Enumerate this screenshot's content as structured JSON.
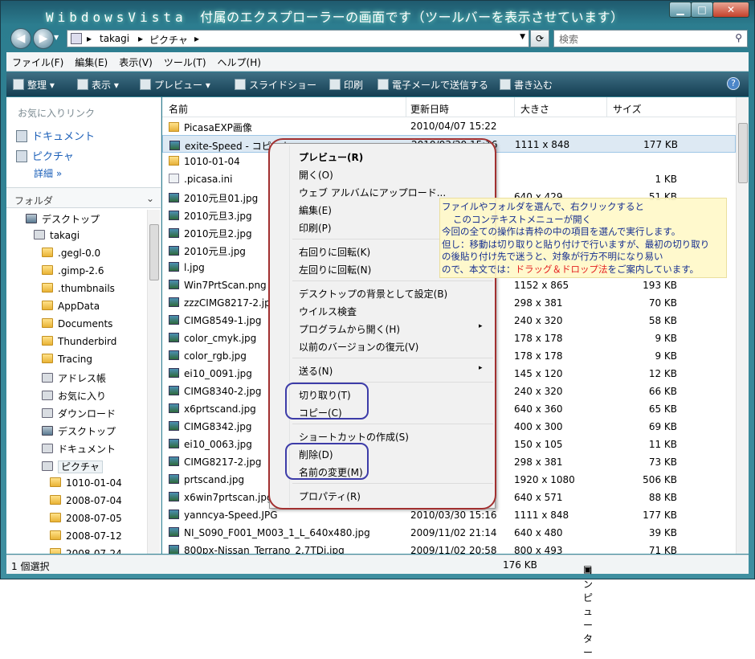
{
  "window": {
    "title_latin": "WibdowsVista",
    "title_rest": "付属のエクスプローラーの画面です（ツールバーを表示させています）",
    "buttons": {
      "minimize": "▁",
      "maximize": "□",
      "close": "✕"
    }
  },
  "address": {
    "crumbs": [
      "takagi",
      "ピクチャ"
    ],
    "separator": "▸",
    "search_placeholder": "検索"
  },
  "menubar": [
    "ファイル(F)",
    "編集(E)",
    "表示(V)",
    "ツール(T)",
    "ヘルプ(H)"
  ],
  "toolbar": {
    "organize": "整理",
    "view": "表示",
    "preview": "プレビュー",
    "slideshow": "スライドショー",
    "print": "印刷",
    "email": "電子メールで送信する",
    "burn": "書き込む",
    "dropdown": "▾",
    "help": "?"
  },
  "nav": {
    "favorites_header": "お気に入りリンク",
    "favorites": [
      "ドキュメント",
      "ピクチャ"
    ],
    "more_label": "詳細",
    "more_glyph": "»",
    "folders_header": "フォルダ",
    "folders_chevron": "⌄",
    "tree": [
      "デスクトップ",
      "takagi",
      ".gegl-0.0",
      ".gimp-2.6",
      ".thumbnails",
      "AppData",
      "Documents",
      "Thunderbird",
      "Tracing",
      "アドレス帳",
      "お気に入り",
      "ダウンロード",
      "デスクトップ",
      "ドキュメント",
      "ピクチャ",
      "1010-01-04",
      "2008-07-04",
      "2008-07-05",
      "2008-07-12",
      "2008-07-24"
    ]
  },
  "columns": {
    "name": "名前",
    "date": "更新日時",
    "dims": "大きさ",
    "size": "サイズ"
  },
  "files": [
    {
      "name": "PicasaEXP画像",
      "date": "2010/04/07 15:22",
      "dims": "",
      "size": ""
    },
    {
      "name": "exite-Speed - コピー.jpg",
      "date": "2010/03/30 15:16",
      "dims": "1111 x 848",
      "size": "177 KB"
    },
    {
      "name": "1010-01-04",
      "date": "",
      "dims": "",
      "size": ""
    },
    {
      "name": ".picasa.ini",
      "date": "",
      "dims": "",
      "size": "1 KB"
    },
    {
      "name": "2010元旦01.jpg",
      "date": "",
      "dims": "640 x 429",
      "size": "51 KB"
    },
    {
      "name": "2010元旦3.jpg",
      "date": "",
      "dims": "",
      "size": ""
    },
    {
      "name": "2010元旦2.jpg",
      "date": "",
      "dims": "",
      "size": ""
    },
    {
      "name": "2010元旦.jpg",
      "date": "",
      "dims": "",
      "size": ""
    },
    {
      "name": "l.jpg",
      "date": "",
      "dims": "",
      "size": ""
    },
    {
      "name": "Win7PrtScan.png",
      "date": "",
      "dims": "1152 x 865",
      "size": "193 KB"
    },
    {
      "name": "zzzCIMG8217-2.jpg",
      "date": "",
      "dims": "298 x 381",
      "size": "70 KB"
    },
    {
      "name": "CIMG8549-1.jpg",
      "date": "",
      "dims": "240 x 320",
      "size": "58 KB"
    },
    {
      "name": "color_cmyk.jpg",
      "date": "",
      "dims": "178 x 178",
      "size": "9 KB"
    },
    {
      "name": "color_rgb.jpg",
      "date": "",
      "dims": "178 x 178",
      "size": "9 KB"
    },
    {
      "name": "ei10_0091.jpg",
      "date": "",
      "dims": "145 x 120",
      "size": "12 KB"
    },
    {
      "name": "CIMG8340-2.jpg",
      "date": "",
      "dims": "240 x 320",
      "size": "66 KB"
    },
    {
      "name": "x6prtscand.jpg",
      "date": "",
      "dims": "640 x 360",
      "size": "65 KB"
    },
    {
      "name": "CIMG8342.jpg",
      "date": "",
      "dims": "400 x 300",
      "size": "69 KB"
    },
    {
      "name": "ei10_0063.jpg",
      "date": "",
      "dims": "150 x 105",
      "size": "11 KB"
    },
    {
      "name": "CIMG8217-2.jpg",
      "date": "",
      "dims": "298 x 381",
      "size": "73 KB"
    },
    {
      "name": "prtscand.jpg",
      "date": "",
      "dims": "1920 x 1080",
      "size": "506 KB"
    },
    {
      "name": "x6win7prtscan.jpg",
      "date": "",
      "dims": "640 x 571",
      "size": "88 KB"
    },
    {
      "name": "yanncya-Speed.JPG",
      "date": "2010/03/30 15:16",
      "dims": "1111 x 848",
      "size": "177 KB"
    },
    {
      "name": "NI_S090_F001_M003_1_L_640x480.jpg",
      "date": "2009/11/02 21:14",
      "dims": "640 x 480",
      "size": "39 KB"
    },
    {
      "name": "800px-Nissan_Terrano_2.7TDi.jpg",
      "date": "2009/11/02 20:58",
      "dims": "800 x 493",
      "size": "71 KB"
    }
  ],
  "context_menu": {
    "items": [
      "プレビュー(R)",
      "開く(O)",
      "ウェブ アルバムにアップロード...",
      "編集(E)",
      "印刷(P)",
      "右回りに回転(K)",
      "左回りに回転(N)",
      "デスクトップの背景として設定(B)",
      "ウイルス検査",
      "プログラムから開く(H)",
      "以前のバージョンの復元(V)",
      "送る(N)",
      "切り取り(T)",
      "コピー(C)",
      "ショートカットの作成(S)",
      "削除(D)",
      "名前の変更(M)",
      "プロパティ(R)"
    ],
    "submenu_arrow": "▸"
  },
  "note": {
    "line1": "ファイルやフォルダを選んで、右クリックすると",
    "line2": "このコンテキストメニューが開く",
    "line3": "今回の全ての操作は青枠の中の項目を選んで実行します。",
    "line4": "但し：移動は切り取りと貼り付けで行いますが、最初の切り取り",
    "line5": "の後貼り付け先で迷うと、対象が行方不明になり易い",
    "line6a": "ので、本文では：",
    "line6b": "ドラッグ＆ドロップ法",
    "line6c": "をご案内しています。"
  },
  "status": {
    "selection": "1 個選択",
    "size": "176 KB",
    "location": "コンピューター"
  },
  "colors": {
    "frame": "#2c7d8f",
    "toolbar": "#1d4a5f",
    "red_ring": "#a23030",
    "blue_ring": "#3d3ca8",
    "note_bg": "#fff9c9",
    "note_text": "#162f90",
    "note_emphasis": "#e42020"
  }
}
